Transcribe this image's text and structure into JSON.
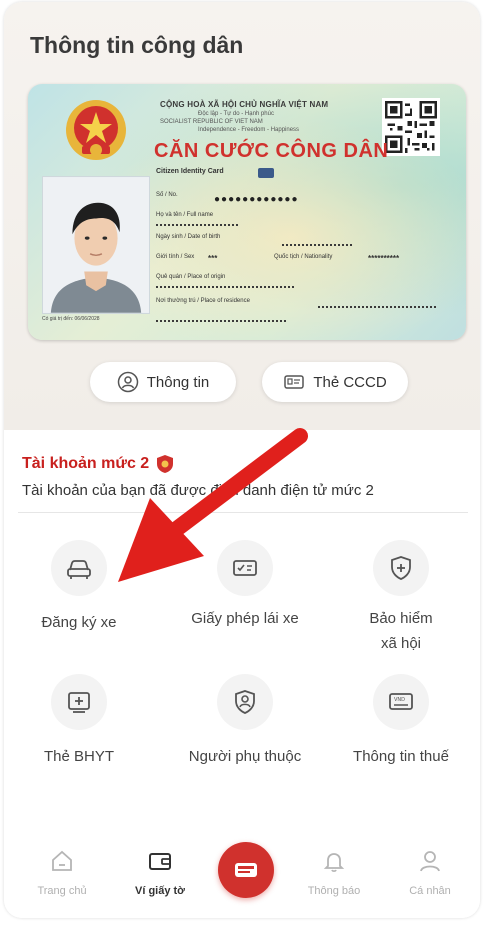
{
  "page": {
    "title": "Thông tin công dân"
  },
  "card": {
    "header_line1": "CỘNG HOÀ XÃ HỘI CHỦ NGHĨA VIỆT NAM",
    "header_line2": "Độc lập - Tự do - Hạnh phúc",
    "header_line3": "SOCIALIST REPUBLIC OF VIET NAM",
    "header_line4": "Independence - Freedom - Happiness",
    "title": "CĂN CƯỚC CÔNG DÂN",
    "subtitle": "Citizen Identity Card",
    "number_label": "Số / No.",
    "number_value": "●●●●●●●●●●●●",
    "name_label": "Họ và tên / Full name",
    "dob_label": "Ngày sinh / Date of birth",
    "sex_label": "Giới tính / Sex",
    "sex_value": "***",
    "nationality_label": "Quốc tịch / Nationality",
    "nationality_value": "**********",
    "origin_label": "Quê quán / Place of origin",
    "residence_label": "Nơi thường trú / Place of residence",
    "expiry_caption": "Có giá trị đến: 06/06/2028"
  },
  "actions": {
    "info_label": "Thông tin",
    "cccd_label": "Thẻ CCCD"
  },
  "account": {
    "level_title": "Tài khoản mức 2",
    "level_desc": "Tài khoản của bạn đã được định danh điện tử mức 2"
  },
  "services": [
    {
      "label": "Đăng ký xe",
      "icon": "car-icon"
    },
    {
      "label": "Giấy phép lái xe",
      "icon": "driver-license-icon"
    },
    {
      "label": "Bảo hiểm xã hội",
      "icon": "shield-plus-icon"
    },
    {
      "label": "Thẻ BHYT",
      "icon": "health-card-icon"
    },
    {
      "label": "Người phụ thuộc",
      "icon": "dependent-icon"
    },
    {
      "label": "Thông tin thuế",
      "icon": "tax-icon"
    }
  ],
  "nav": {
    "home": "Trang chủ",
    "wallet": "Ví giấy tờ",
    "notifications": "Thông báo",
    "profile": "Cá nhân"
  },
  "colors": {
    "accent": "#d0312d",
    "arrow": "#e0201c"
  }
}
